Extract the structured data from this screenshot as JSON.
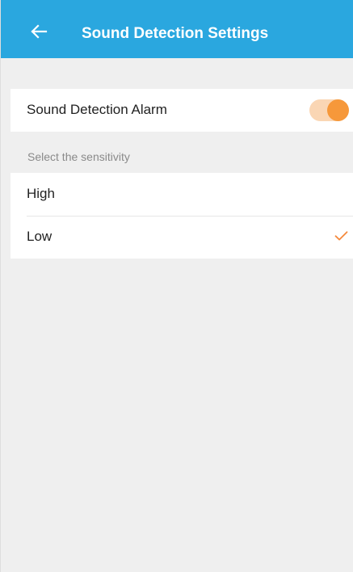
{
  "header": {
    "title": "Sound Detection Settings",
    "back_icon": "arrow-left-icon",
    "background_color": "#2aa7df"
  },
  "alarm": {
    "label": "Sound Detection Alarm",
    "enabled": true,
    "toggle_color": "#f6983a"
  },
  "sensitivity": {
    "section_label": "Select the sensitivity",
    "options": [
      {
        "label": "High",
        "selected": false
      },
      {
        "label": "Low",
        "selected": true
      }
    ],
    "check_icon": "checkmark-icon",
    "check_color": "#f58a3d"
  }
}
